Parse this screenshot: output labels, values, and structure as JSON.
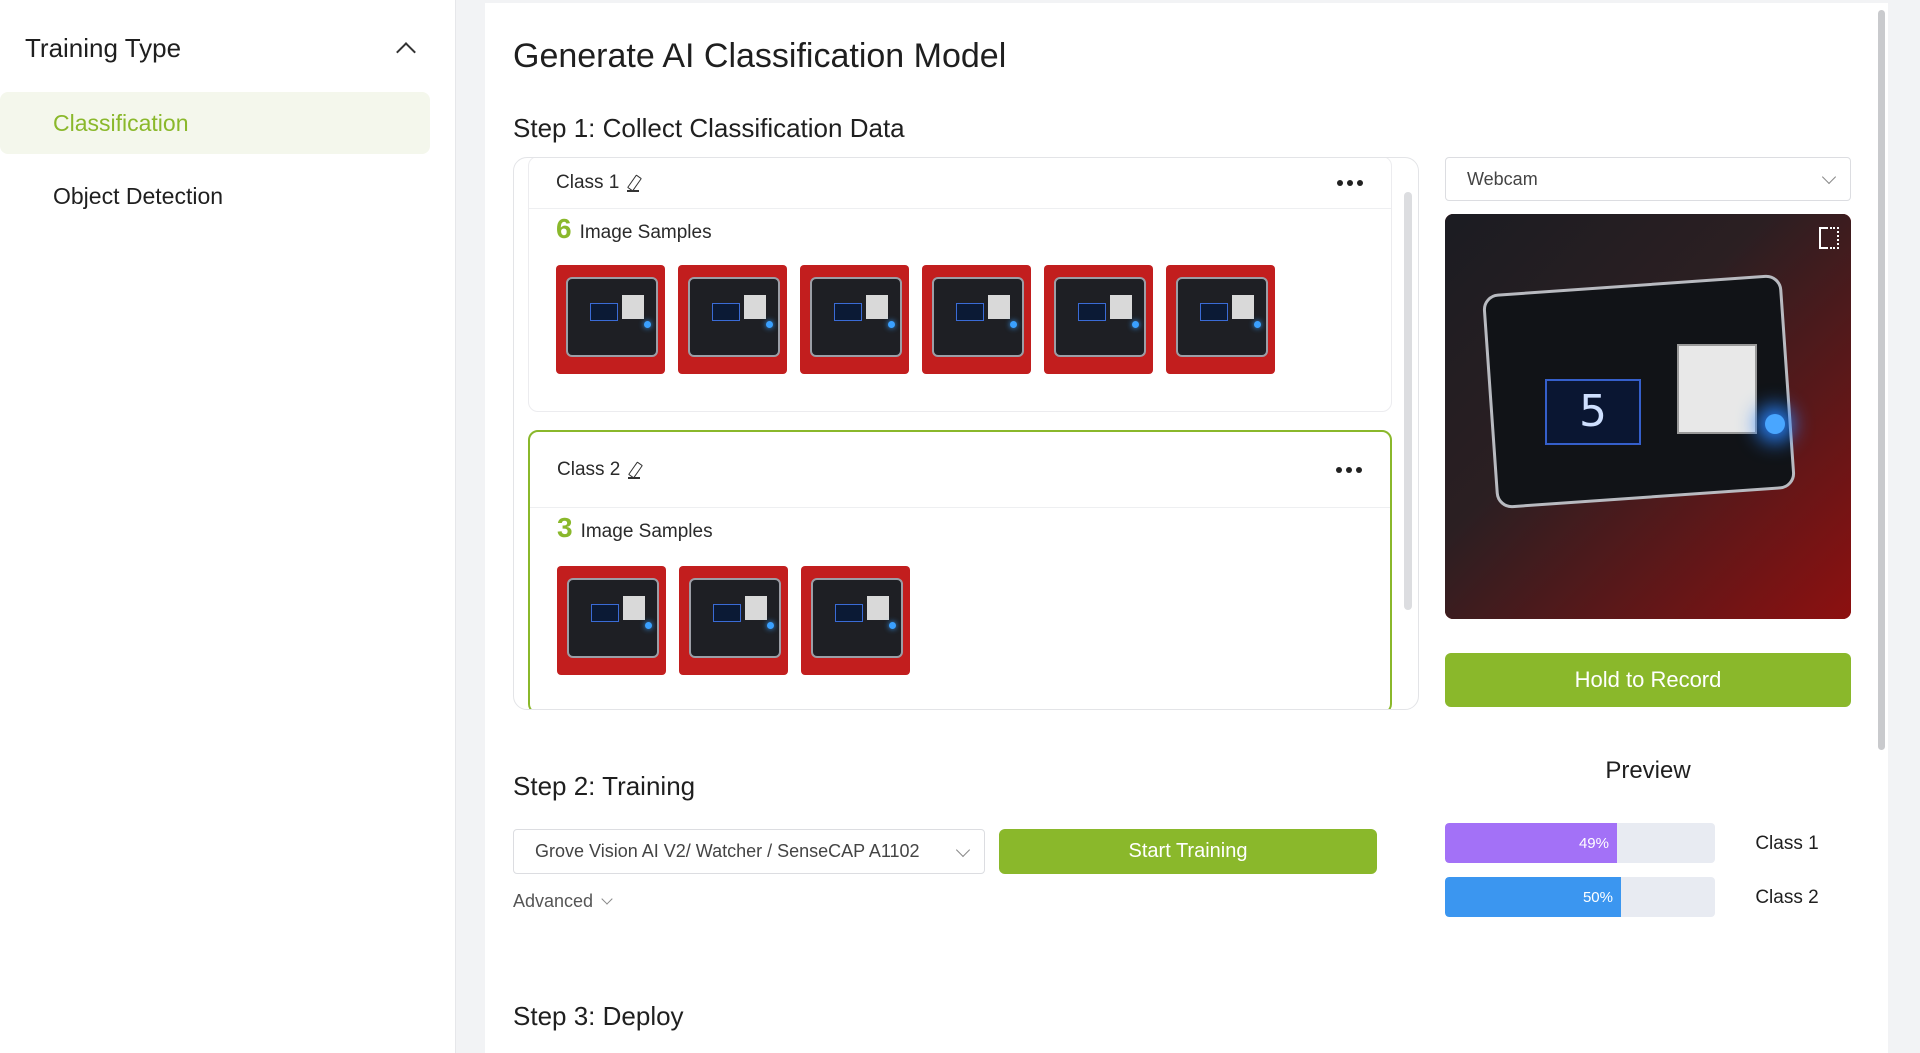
{
  "sidebar": {
    "title": "Training Type",
    "items": [
      {
        "label": "Classification",
        "active": true
      },
      {
        "label": "Object Detection",
        "active": false
      }
    ]
  },
  "main": {
    "title": "Generate AI Classification Model",
    "step1": "Step 1: Collect Classification Data",
    "step2": "Step 2: Training",
    "step3": "Step 3: Deploy"
  },
  "classes": [
    {
      "name": "Class 1",
      "count": "6",
      "samples_label": "Image Samples"
    },
    {
      "name": "Class 2",
      "count": "3",
      "samples_label": "Image Samples"
    }
  ],
  "camera": {
    "source": "Webcam",
    "record_label": "Hold to Record",
    "display_digit": "5"
  },
  "training": {
    "device": "Grove Vision AI V2/ Watcher / SenseCAP A1102",
    "start_label": "Start Training",
    "advanced_label": "Advanced"
  },
  "preview": {
    "title": "Preview",
    "results": [
      {
        "label": "Class 1",
        "percent": 49,
        "percent_text": "49%",
        "color": "#a371f7"
      },
      {
        "label": "Class 2",
        "percent": 50,
        "percent_text": "50%",
        "color": "#3b96f0"
      }
    ]
  },
  "colors": {
    "accent": "#8ab82b"
  }
}
